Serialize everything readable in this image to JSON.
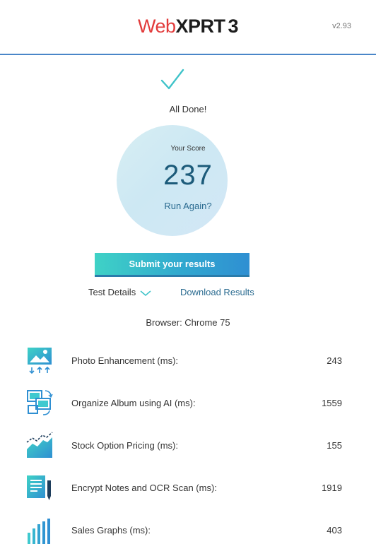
{
  "header": {
    "brand_web": "Web",
    "brand_xprt": "XPRT",
    "brand_num": "3",
    "version": "v2.93"
  },
  "status": {
    "done_text": "All Done!"
  },
  "score": {
    "label": "Your Score",
    "value": "237",
    "run_again": "Run Again?"
  },
  "actions": {
    "submit_label": "Submit your results",
    "test_details_label": "Test Details",
    "download_label": "Download Results"
  },
  "browser_info": "Browser: Chrome 75",
  "results": [
    {
      "icon": "photo-enhancement-icon",
      "name": "Photo Enhancement (ms):",
      "value": "243"
    },
    {
      "icon": "organize-album-icon",
      "name": "Organize Album using AI (ms):",
      "value": "1559"
    },
    {
      "icon": "stock-chart-icon",
      "name": "Stock Option Pricing (ms):",
      "value": "155"
    },
    {
      "icon": "encrypt-notes-icon",
      "name": "Encrypt Notes and OCR Scan (ms):",
      "value": "1919"
    },
    {
      "icon": "sales-graphs-icon",
      "name": "Sales Graphs (ms):",
      "value": "403"
    }
  ],
  "colors": {
    "brand_red": "#e23b3b",
    "accent_teal": "#3fc9cf",
    "link_blue": "#2a6b90",
    "header_line": "#4a86c8"
  }
}
